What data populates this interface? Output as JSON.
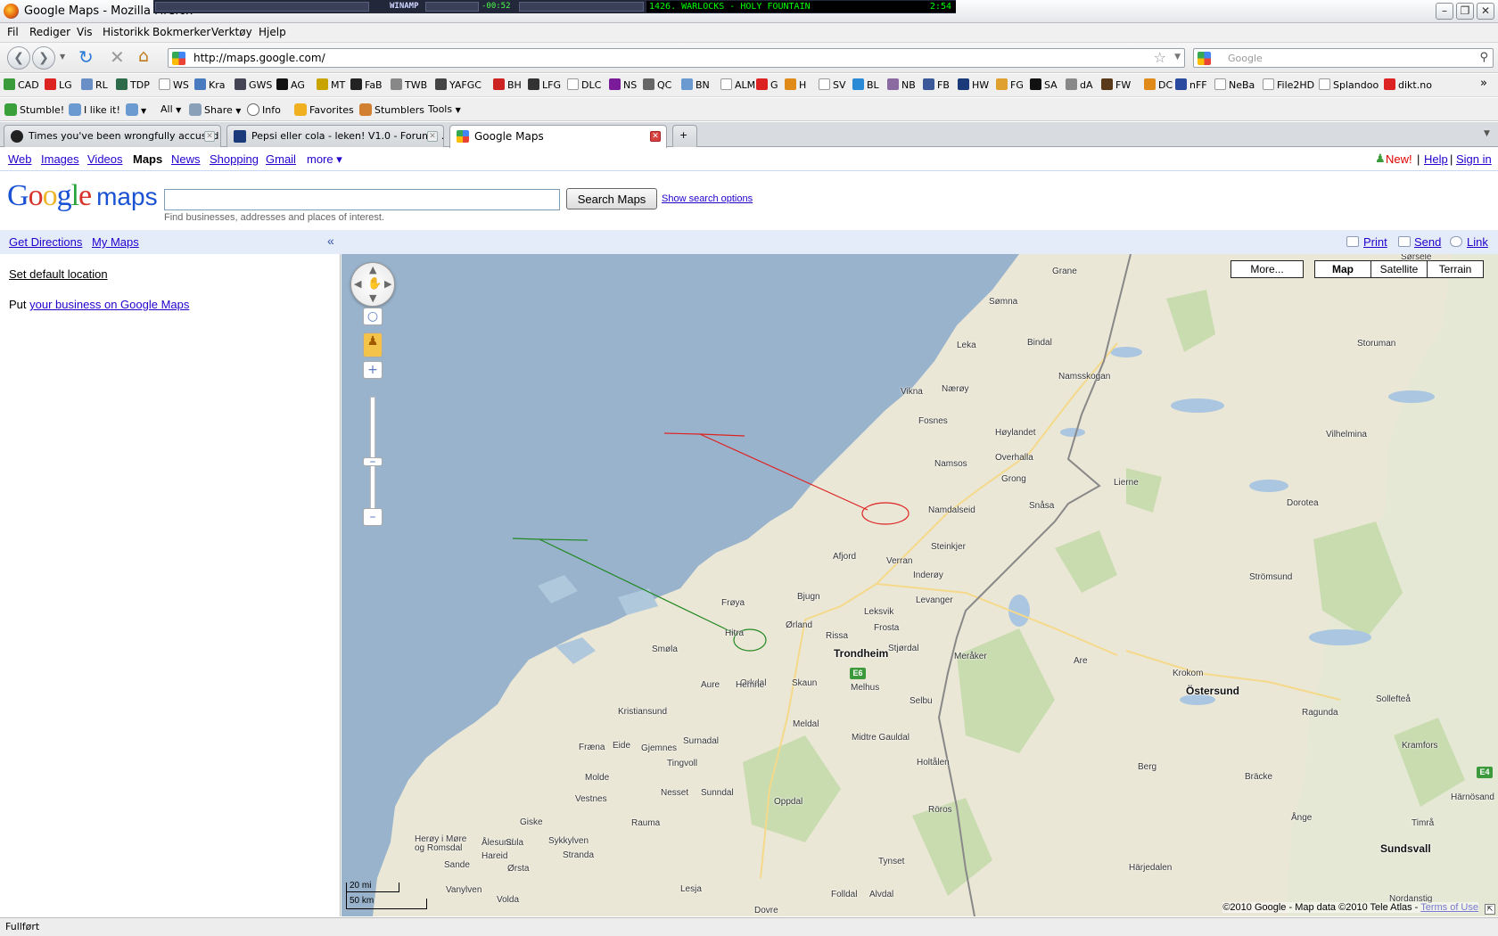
{
  "window": {
    "title": "Google Maps - Mozilla Firefox"
  },
  "winamp": {
    "name": "WINAMP",
    "elapsed": "-00:52",
    "song": "1426. WARLOCKS - HOLY FOUNTAIN",
    "time": "2:54"
  },
  "menu": [
    "Fil",
    "Rediger",
    "Vis",
    "Historikk",
    "Bokmerker",
    "Verktøy",
    "Hjelp"
  ],
  "nav": {
    "url": "http://maps.google.com/",
    "search_placeholder": "Google"
  },
  "bookmarks": [
    "CAD",
    "LG",
    "RL",
    "TDP",
    "WS",
    "Kra",
    "GWS",
    "AG",
    "MT",
    "FaB",
    "TWB",
    "YAFGC",
    "BH",
    "LFG",
    "DLC",
    "NS",
    "QC",
    "BN",
    "ALM",
    "G",
    "H",
    "SV",
    "BL",
    "NB",
    "FB",
    "HW",
    "FG",
    "SA",
    "dA",
    "FW",
    "DC",
    "nFF",
    "NeBa",
    "File2HD",
    "Splandoo",
    "dikt.no"
  ],
  "stumble": {
    "stumble": "Stumble!",
    "like": "I like it!",
    "all": "All",
    "share": "Share",
    "info": "Info",
    "favorites": "Favorites",
    "stumblers": "Stumblers",
    "tools": "Tools"
  },
  "tabs": [
    {
      "label": "Times you've been wrongfully accused ..."
    },
    {
      "label": "Pepsi eller cola - leken! V1.0 - Forum - ..."
    },
    {
      "label": "Google Maps"
    }
  ],
  "gbar": {
    "web": "Web",
    "images": "Images",
    "videos": "Videos",
    "maps": "Maps",
    "news": "News",
    "shopping": "Shopping",
    "gmail": "Gmail",
    "more": "more ▾",
    "new": "New!",
    "help": "Help",
    "signin": "Sign in",
    "sep": "|"
  },
  "header": {
    "logo_maps": "maps",
    "search_button": "Search Maps",
    "show_options": "Show search options",
    "hint": "Find businesses, addresses and places of interest.",
    "search_value": ""
  },
  "toolbar": {
    "get_directions": "Get Directions",
    "my_maps": "My Maps",
    "collapse": "«",
    "print": "Print",
    "send": "Send",
    "link": "Link"
  },
  "sidebar": {
    "set_default": "Set default location",
    "put": "Put",
    "business_link": "your business on Google Maps"
  },
  "map": {
    "types": {
      "more": "More...",
      "map": "Map",
      "satellite": "Satellite",
      "terrain": "Terrain",
      "selected": "Map"
    },
    "scale": {
      "mi": "20 mi",
      "km": "50 km"
    },
    "copyright": "©2010 Google - Map data ©2010 Tele Atlas - ",
    "terms": "Terms of Use",
    "shield_e6": "E6",
    "shield_e4": "E4",
    "places": [
      "Grane",
      "Sørsele",
      "Sømna",
      "Bindal",
      "Storuman",
      "Leka",
      "Vikna",
      "Nærøy",
      "Namsskogan",
      "Fosnes",
      "Høylandet",
      "Vilhelmina",
      "Namsos",
      "Overhalla",
      "Grong",
      "Lierne",
      "Namdalseid",
      "Snåsa",
      "Dorotea",
      "Steinkjer",
      "Afjord",
      "Verran",
      "Inderøy",
      "Strömsund",
      "Levanger",
      "Bjugn",
      "Frøya",
      "Leksvik",
      "Ørland",
      "Frosta",
      "Hitra",
      "Rissa",
      "Stjørdal",
      "Trondheim",
      "Smøla",
      "Meråker",
      "Are",
      "Krokom",
      "Orkdal",
      "Skaun",
      "Melhus",
      "Aure",
      "Hemne",
      "Östersund",
      "Selbu",
      "Kristiansund",
      "Ragunda",
      "Sollefteå",
      "Meldal",
      "Fræna",
      "Eide",
      "Gjemnes",
      "Surnadal",
      "Midtre Gauldal",
      "Tingvoll",
      "Kramfors",
      "Molde",
      "Holtålen",
      "Berg",
      "Bräcke",
      "Nesset",
      "Sunndal",
      "Vestnes",
      "Oppdal",
      "Härnösand",
      "Röros",
      "Ånge",
      "Giske",
      "Rauma",
      "Timrå",
      "Ålesund",
      "Sula",
      "Herøy i Møre og Romsdal",
      "Sykkylven",
      "Sundsvall",
      "Sande",
      "Ørsta",
      "Stranda",
      "Tynset",
      "Härjedalen",
      "Hareid",
      "Vanylven",
      "Volda",
      "Lesja",
      "Folldal",
      "Alvdal",
      "Nordanstig",
      "Dovre"
    ]
  },
  "status": "Fullført"
}
